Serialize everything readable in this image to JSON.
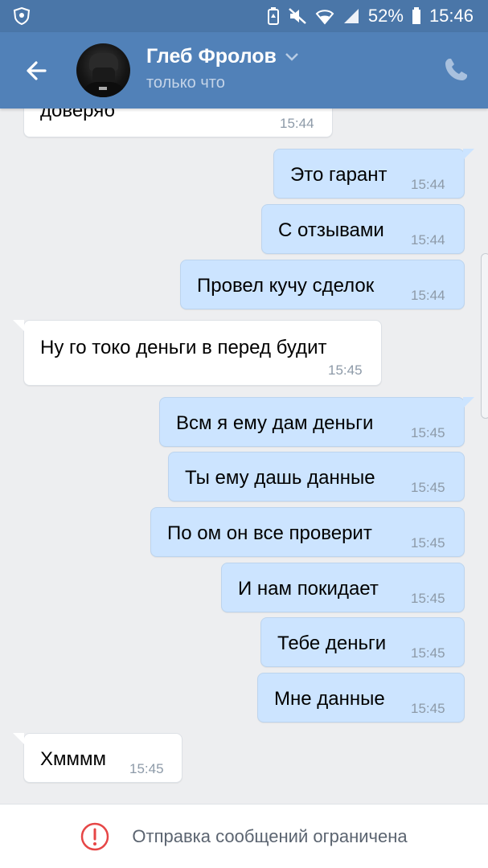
{
  "status_bar": {
    "battery": "52%",
    "time": "15:46"
  },
  "header": {
    "contact_name": "Глеб Фролов",
    "contact_status": "только что"
  },
  "messages": [
    {
      "dir": "in",
      "text": "доверяб",
      "time": "15:44"
    },
    {
      "dir": "out",
      "text": "Это гарант",
      "time": "15:44"
    },
    {
      "dir": "out",
      "text": "С отзывами",
      "time": "15:44"
    },
    {
      "dir": "out",
      "text": "Провел кучу сделок",
      "time": "15:44"
    },
    {
      "dir": "in",
      "text": "Ну го токо деньги в перед будит",
      "time": "15:45"
    },
    {
      "dir": "out",
      "text": "Всм я ему дам деньги",
      "time": "15:45"
    },
    {
      "dir": "out",
      "text": "Ты ему дашь данные",
      "time": "15:45"
    },
    {
      "dir": "out",
      "text": "По ом он все проверит",
      "time": "15:45"
    },
    {
      "dir": "out",
      "text": "И нам покидает",
      "time": "15:45"
    },
    {
      "dir": "out",
      "text": "Тебе деньги",
      "time": "15:45"
    },
    {
      "dir": "out",
      "text": "Мне данные",
      "time": "15:45"
    },
    {
      "dir": "in",
      "text": "Хмммм",
      "time": "15:45"
    }
  ],
  "footer": {
    "restriction_text": "Отправка сообщений ограничена"
  },
  "colors": {
    "header_bg": "#5181b8",
    "statusbar_bg": "#4a76a8",
    "outgoing_bubble": "#cce4ff",
    "incoming_bubble": "#ffffff",
    "chat_bg": "#edeef0",
    "warning_red": "#e64646"
  },
  "icons": {
    "back": "arrow-left-icon",
    "call": "phone-icon",
    "dropdown": "chevron-down-icon",
    "warning": "exclamation-circle-icon"
  }
}
